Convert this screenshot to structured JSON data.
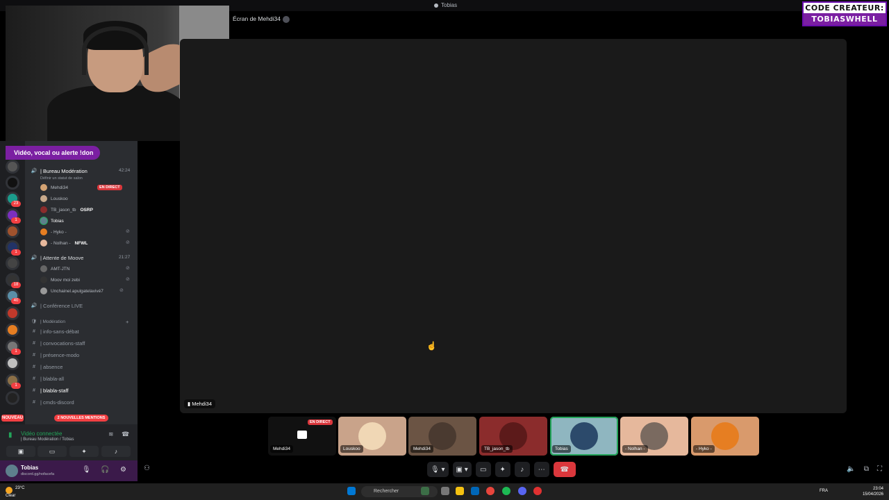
{
  "window": {
    "title": "Tobias"
  },
  "overlay": {
    "creator_line1": "CODE CREATEUR:",
    "creator_line2": "TOBIASWHELL",
    "alert_banner": "Vidéo, vocal ou alerte !don"
  },
  "rail": {
    "badges": [
      "23",
      "1",
      "1",
      "18",
      "40",
      "1",
      "1"
    ],
    "nouveau": "NOUVEAU"
  },
  "channels": {
    "voice1": {
      "name": "| Bureau Modération",
      "timer": "42:24",
      "status": "Définir un statut de salon"
    },
    "voice1_users": [
      {
        "name": "Mehdi34",
        "tag": "EN DIRECT"
      },
      {
        "name": "Louskoo",
        "tag": ""
      },
      {
        "name": "TB_jason_tb",
        "tag": "OSRP"
      },
      {
        "name": "Tobias",
        "tag": ""
      },
      {
        "name": "- Hyko -",
        "tag": ""
      },
      {
        "name": "- Nolhan -",
        "tag": "NFWL"
      }
    ],
    "voice2": {
      "name": "| Attente de Moove",
      "timer": "21:27"
    },
    "voice2_users": [
      {
        "name": "AMT-JTN"
      },
      {
        "name": "Moov moi zebi"
      },
      {
        "name": "Unchainel.apulgatelavivé7"
      }
    ],
    "voice3": {
      "name": "| Conférence LIVE"
    },
    "category": "| Modération",
    "text_channels": [
      "| info-sans-débat",
      "| convocations-staff",
      "| présence-modo",
      "| absence",
      "| blabla-all",
      "| blabla-staff",
      "| cmds-discord"
    ],
    "mentions": "2 NOUVELLES MENTIONS"
  },
  "voice_panel": {
    "title": "Vidéo connectée",
    "subtitle": "| Bureau Modération / Tobias"
  },
  "user_panel": {
    "name": "Tobias",
    "status": "discord.gg/nofacefa"
  },
  "stage": {
    "title": "Écran de Mehdi34",
    "label": "Mehdi34"
  },
  "tiles": [
    {
      "label": "Mehdi34",
      "live": "EN DIRECT"
    },
    {
      "label": "Louskoo"
    },
    {
      "label": "Mehdi34"
    },
    {
      "label": "TB_jason_tb"
    },
    {
      "label": "Tobias"
    },
    {
      "label": "- Nolhan -"
    },
    {
      "label": "- Hyko -"
    }
  ],
  "taskbar": {
    "temp": "23°C",
    "weather": "Clear",
    "search_placeholder": "Rechercher",
    "lang": "FRA",
    "time": "23:04",
    "date": "15/04/2026"
  },
  "colors": {
    "accent_purple": "#7b1fa2",
    "live_red": "#da373c",
    "connected_green": "#23a55a"
  }
}
